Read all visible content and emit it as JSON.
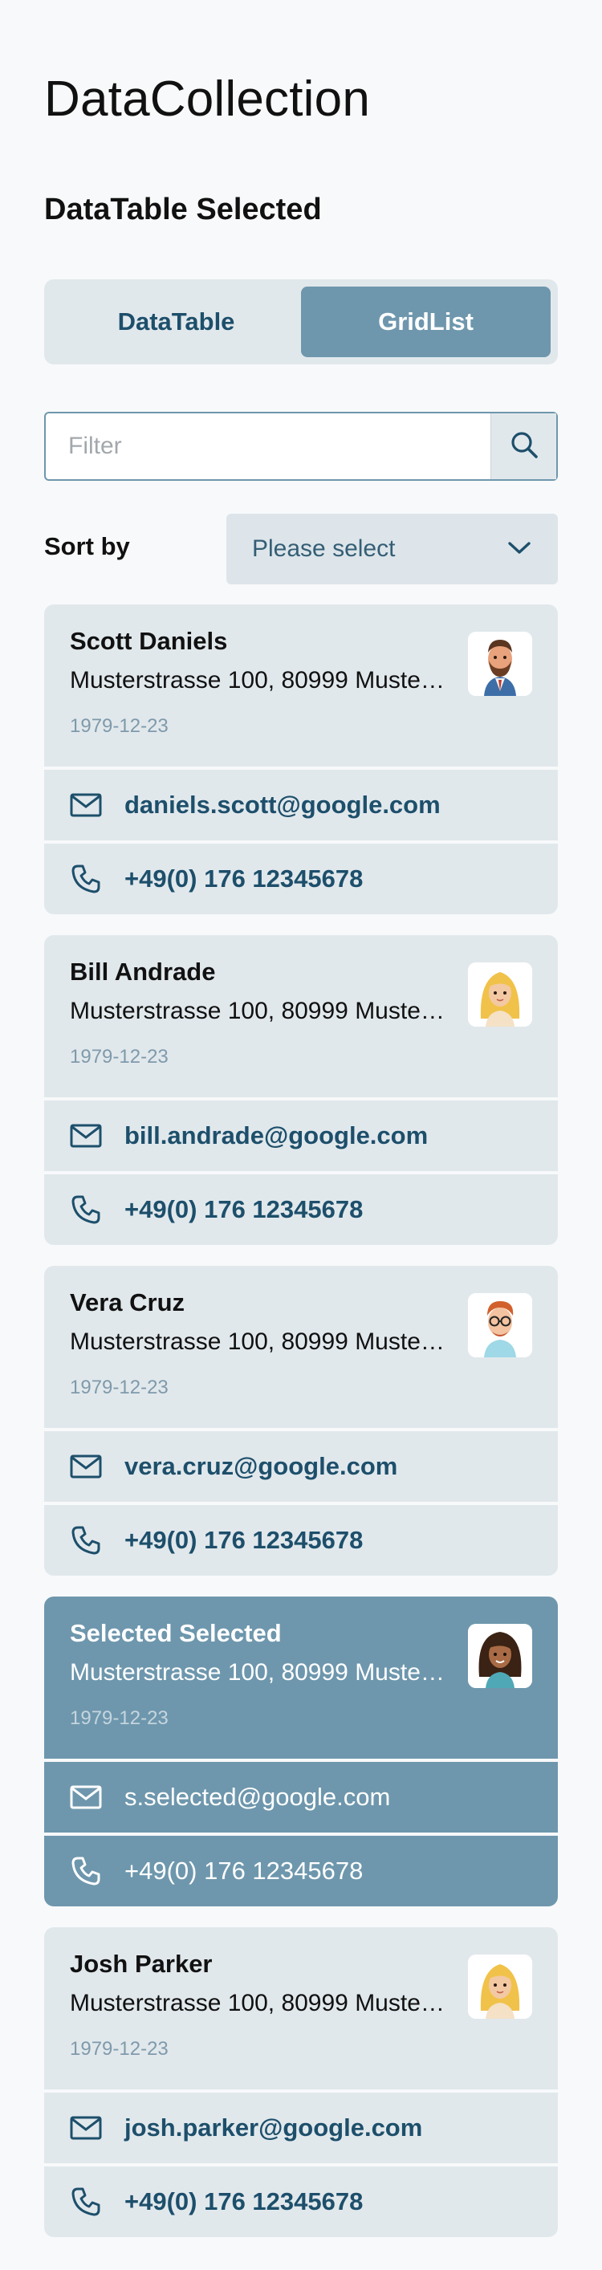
{
  "app": {
    "title": "DataCollection"
  },
  "section": {
    "title": "DataTable Selected"
  },
  "view_toggle": {
    "options": [
      "DataTable",
      "GridList"
    ],
    "selected": "GridList"
  },
  "filter": {
    "placeholder": "Filter",
    "value": ""
  },
  "sort": {
    "label": "Sort by",
    "value": "Please select"
  },
  "contacts": [
    {
      "name": "Scott Daniels",
      "address": "Musterstrasse 100, 80999 Muster...",
      "dob": "1979-12-23",
      "email": "daniels.scott@google.com",
      "phone": "+49(0) 176 12345678",
      "selected": false,
      "avatar": "avatar-bearded-man"
    },
    {
      "name": "Bill Andrade",
      "address": "Musterstrasse 100, 80999 Muster...",
      "dob": "1979-12-23",
      "email": "bill.andrade@google.com",
      "phone": "+49(0) 176 12345678",
      "selected": false,
      "avatar": "avatar-blonde-woman"
    },
    {
      "name": "Vera Cruz",
      "address": "Musterstrasse 100, 80999 Muster...",
      "dob": "1979-12-23",
      "email": "vera.cruz@google.com",
      "phone": "+49(0) 176 12345678",
      "selected": false,
      "avatar": "avatar-redhead-glasses-man"
    },
    {
      "name": "Selected Selected",
      "address": "Musterstrasse 100, 80999 Muster...",
      "dob": "1979-12-23",
      "email": "s.selected@google.com",
      "phone": "+49(0) 176 12345678",
      "selected": true,
      "avatar": "avatar-curly-hair-woman"
    },
    {
      "name": "Josh Parker",
      "address": "Musterstrasse 100, 80999 Muster...",
      "dob": "1979-12-23",
      "email": "josh.parker@google.com",
      "phone": "+49(0) 176 12345678",
      "selected": false,
      "avatar": "avatar-blonde-woman"
    }
  ],
  "colors": {
    "accent": "#6e97ad",
    "surface": "#e1e8ec",
    "link_text": "#1d4f6b",
    "muted": "#7f9aab"
  }
}
